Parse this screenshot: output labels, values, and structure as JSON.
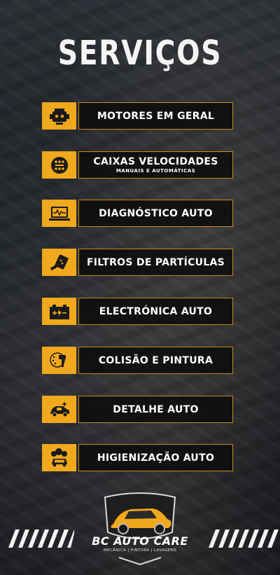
{
  "title": "SERVIÇOS",
  "services": [
    {
      "label": "MOTORES EM GERAL",
      "sublabel": "",
      "icon": "engine-icon"
    },
    {
      "label": "CAIXAS VELOCIDADES",
      "sublabel": "MANUAIS E AUTOMÁTICAS",
      "icon": "gearbox-icon"
    },
    {
      "label": "DIAGNÓSTICO AUTO",
      "sublabel": "",
      "icon": "diagnostic-laptop-icon"
    },
    {
      "label": "FILTROS DE PARTÍCULAS",
      "sublabel": "",
      "icon": "particle-filter-icon"
    },
    {
      "label": "ELECTRÓNICA AUTO",
      "sublabel": "",
      "icon": "battery-icon"
    },
    {
      "label": "COLISÃO E PINTURA",
      "sublabel": "",
      "icon": "spray-gun-icon"
    },
    {
      "label": "DETALHE AUTO",
      "sublabel": "",
      "icon": "car-detailing-icon"
    },
    {
      "label": "HIGIENIZAÇÃO AUTO",
      "sublabel": "",
      "icon": "car-wash-icon"
    }
  ],
  "brand": {
    "name": "BC AUTO CARE",
    "tagline": "MECÂNICA | PINTURA | LAVAGENS"
  },
  "colors": {
    "accent": "#f0a81c",
    "border": "#c58a1a",
    "text": "#ffffff"
  }
}
